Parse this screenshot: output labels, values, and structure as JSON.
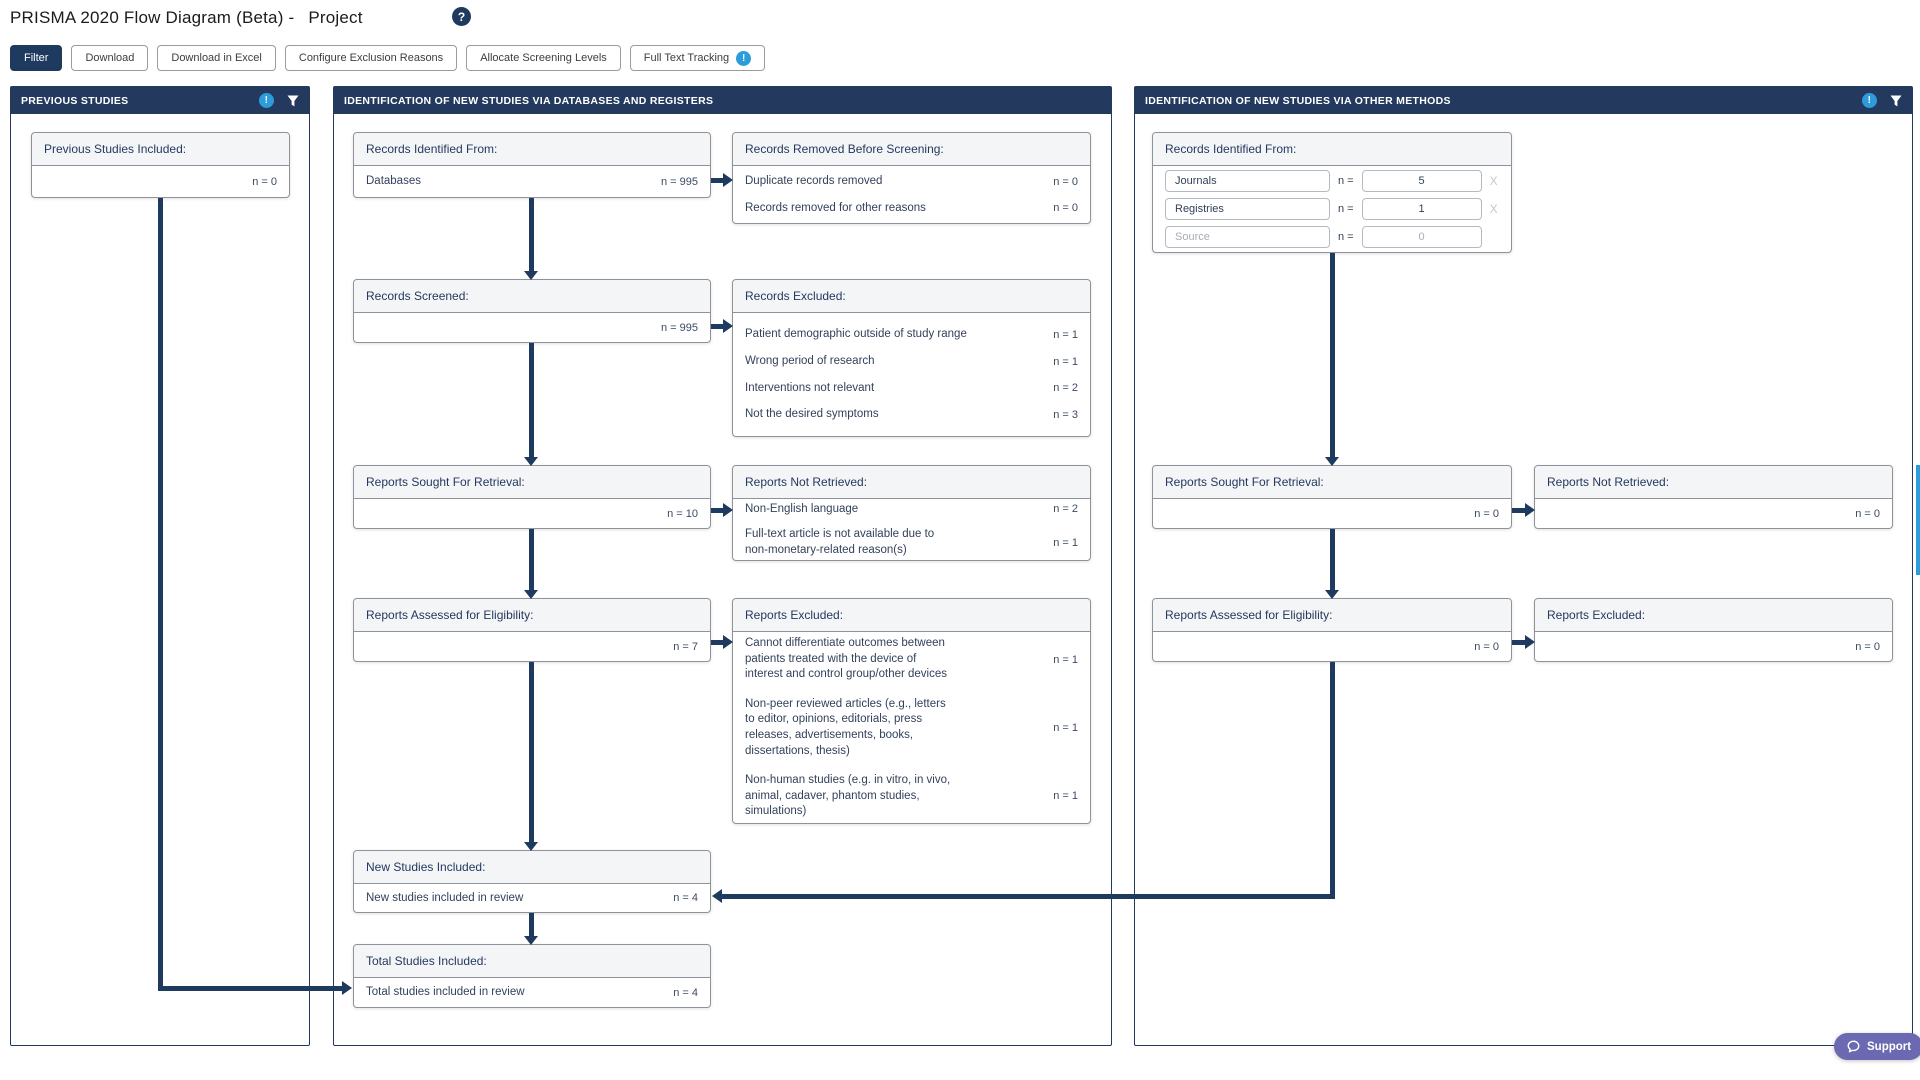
{
  "header": {
    "title": "PRISMA 2020 Flow Diagram (Beta) -",
    "project": "Project",
    "help_glyph": "?"
  },
  "toolbar": {
    "filter": "Filter",
    "download": "Download",
    "download_excel": "Download in Excel",
    "configure_exclusion": "Configure Exclusion Reasons",
    "allocate_screening": "Allocate Screening Levels",
    "full_text_tracking": "Full Text Tracking",
    "tracking_badge": "!"
  },
  "icons": {
    "info_glyph": "!"
  },
  "panels": {
    "previous": {
      "title": "PREVIOUS STUDIES",
      "included": {
        "title": "Previous Studies Included:",
        "n": "n = 0"
      }
    },
    "databases": {
      "title": "IDENTIFICATION OF NEW STUDIES VIA DATABASES AND REGISTERS",
      "records_identified": {
        "title": "Records Identified From:",
        "rows": [
          {
            "label": "Databases",
            "n": "n = 995"
          }
        ]
      },
      "records_removed": {
        "title": "Records Removed Before Screening:",
        "rows": [
          {
            "label": "Duplicate records removed",
            "n": "n = 0"
          },
          {
            "label": "Records removed for other reasons",
            "n": "n = 0"
          }
        ]
      },
      "records_screened": {
        "title": "Records Screened:",
        "n": "n = 995"
      },
      "records_excluded": {
        "title": "Records Excluded:",
        "rows": [
          {
            "label": "Patient demographic outside of study range",
            "n": "n = 1"
          },
          {
            "label": "Wrong period of research",
            "n": "n = 1"
          },
          {
            "label": "Interventions not relevant",
            "n": "n = 2"
          },
          {
            "label": "Not the desired symptoms",
            "n": "n = 3"
          }
        ]
      },
      "reports_sought": {
        "title": "Reports Sought For Retrieval:",
        "n": "n = 10"
      },
      "reports_not_retrieved": {
        "title": "Reports Not Retrieved:",
        "rows": [
          {
            "label": "Non-English language",
            "n": "n = 2"
          },
          {
            "label": "Full-text article is not available due to non-monetary-related reason(s)",
            "n": "n = 1"
          }
        ]
      },
      "reports_assessed": {
        "title": "Reports Assessed for Eligibility:",
        "n": "n = 7"
      },
      "reports_excluded": {
        "title": "Reports Excluded:",
        "rows": [
          {
            "label": "Cannot differentiate outcomes between patients treated with the device of interest and control group/other devices",
            "n": "n = 1"
          },
          {
            "label": "Non-peer reviewed articles (e.g., letters to editor, opinions, editorials, press releases, advertisements, books, dissertations, thesis)",
            "n": "n = 1"
          },
          {
            "label": "Non-human studies (e.g. in vitro, in vivo, animal, cadaver, phantom studies, simulations)",
            "n": "n = 1"
          }
        ]
      },
      "new_studies": {
        "title": "New Studies Included:",
        "rows": [
          {
            "label": "New studies included in review",
            "n": "n = 4"
          }
        ]
      },
      "total_studies": {
        "title": "Total Studies Included:",
        "rows": [
          {
            "label": "Total studies included in review",
            "n": "n = 4"
          }
        ]
      }
    },
    "other": {
      "title": "IDENTIFICATION OF NEW STUDIES VIA OTHER METHODS",
      "records_identified": {
        "title": "Records Identified From:",
        "n_label": "n =",
        "remove_label": "X",
        "inputs": [
          {
            "source": "Journals",
            "value": "5"
          },
          {
            "source": "Registries",
            "value": "1"
          },
          {
            "source_placeholder": "Source",
            "value_placeholder": "0"
          }
        ]
      },
      "reports_sought": {
        "title": "Reports Sought For Retrieval:",
        "n": "n = 0"
      },
      "reports_not_retrieved": {
        "title": "Reports Not Retrieved:",
        "n": "n = 0"
      },
      "reports_assessed": {
        "title": "Reports Assessed for Eligibility:",
        "n": "n = 0"
      },
      "reports_excluded": {
        "title": "Reports Excluded:",
        "n": "n = 0"
      }
    }
  },
  "support": {
    "label": "Support"
  }
}
